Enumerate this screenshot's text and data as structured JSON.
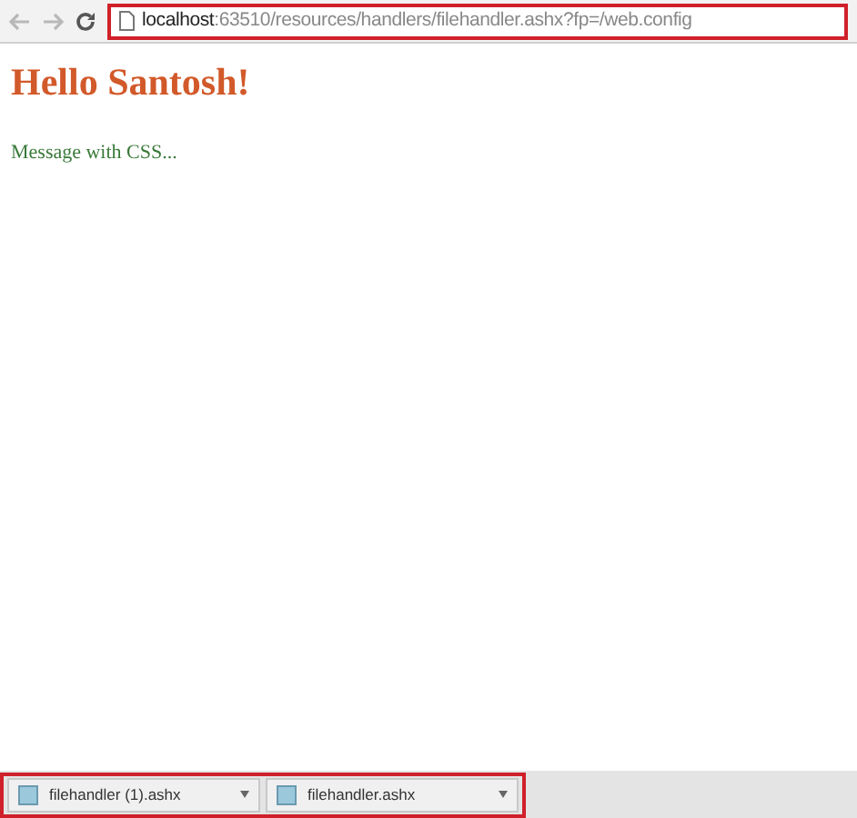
{
  "address_bar": {
    "host": "localhost",
    "path": ":63510/resources/handlers/filehandler.ashx?fp=/web.config"
  },
  "page": {
    "heading": "Hello Santosh!",
    "message": "Message with CSS..."
  },
  "downloads": [
    {
      "name": "filehandler (1).ashx"
    },
    {
      "name": "filehandler.ashx"
    }
  ]
}
